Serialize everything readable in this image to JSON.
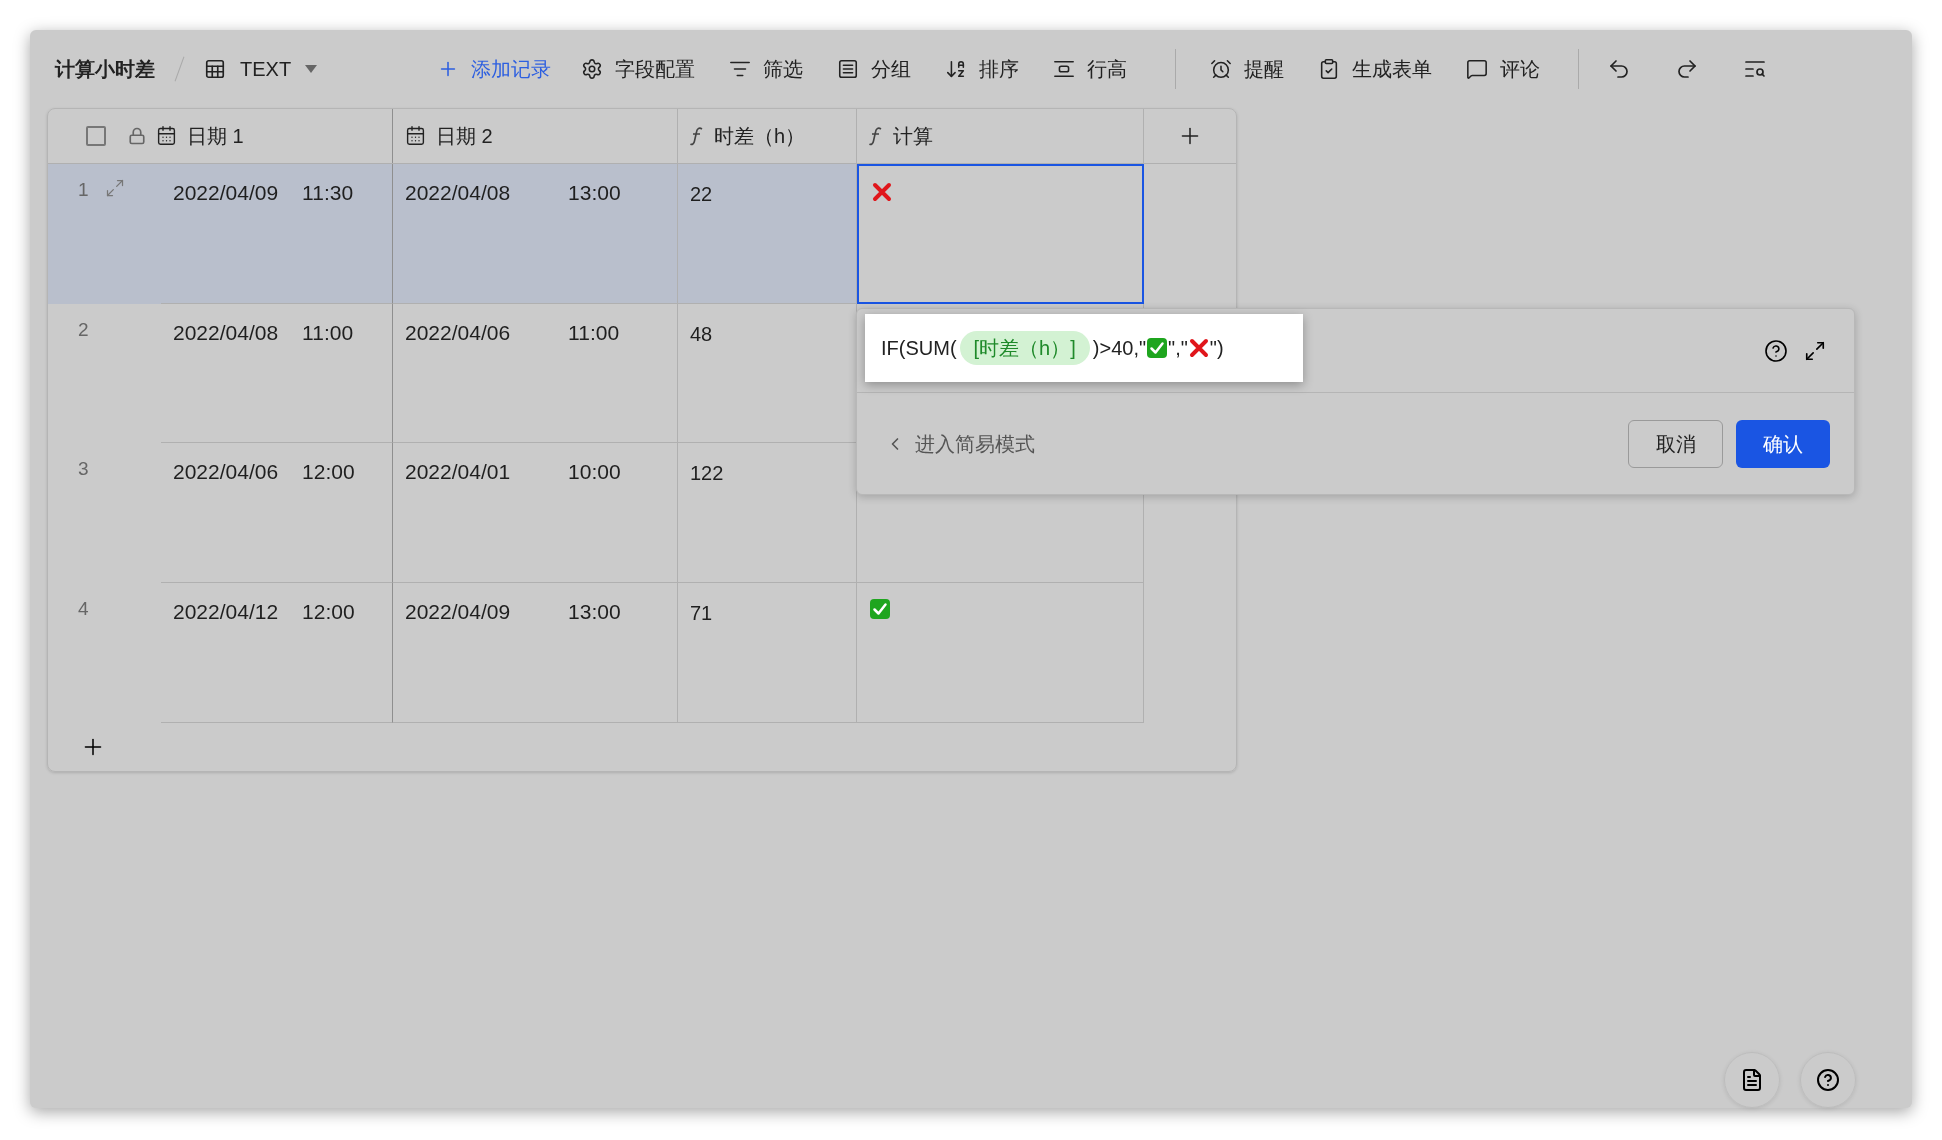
{
  "app": {
    "title": "计算小时差"
  },
  "view": {
    "name": "TEXT"
  },
  "toolbar_groups": [
    [
      {
        "kind": "add",
        "label": "添加记录"
      },
      {
        "kind": "fields",
        "label": "字段配置"
      },
      {
        "kind": "filter",
        "label": "筛选"
      },
      {
        "kind": "group",
        "label": "分组"
      },
      {
        "kind": "sort",
        "label": "排序"
      },
      {
        "kind": "row_height",
        "label": "行高"
      }
    ],
    [
      {
        "kind": "reminder",
        "label": "提醒"
      },
      {
        "kind": "form",
        "label": "生成表单"
      },
      {
        "kind": "comment",
        "label": "评论"
      }
    ]
  ],
  "table": {
    "select_all": {
      "checked": false
    },
    "columns": [
      {
        "kind": "date",
        "label": "日期 1",
        "locked": true
      },
      {
        "kind": "date",
        "label": "日期 2",
        "locked": false
      },
      {
        "kind": "formula",
        "label": "时差（h）",
        "locked": false
      },
      {
        "kind": "formula",
        "label": "计算",
        "locked": false
      }
    ],
    "rows": [
      {
        "number": "1",
        "selected": true,
        "date_1": {
          "date": "2022/04/09",
          "time": "11:30"
        },
        "date_2": {
          "date": "2022/04/08",
          "time": "13:00"
        },
        "diff": "22",
        "result": {
          "kind": "cross"
        },
        "active_cell": true
      },
      {
        "number": "2",
        "selected": false,
        "date_1": {
          "date": "2022/04/08",
          "time": "11:00"
        },
        "date_2": {
          "date": "2022/04/06",
          "time": "11:00"
        },
        "diff": "48",
        "active_cell": false
      },
      {
        "number": "3",
        "selected": false,
        "date_1": {
          "date": "2022/04/06",
          "time": "12:00"
        },
        "date_2": {
          "date": "2022/04/01",
          "time": "10:00"
        },
        "diff": "122",
        "active_cell": false
      },
      {
        "number": "4",
        "selected": false,
        "date_1": {
          "date": "2022/04/12",
          "time": "12:00"
        },
        "date_2": {
          "date": "2022/04/09",
          "time": "13:00"
        },
        "diff": "71",
        "result": {
          "kind": "check"
        },
        "active_cell": false
      }
    ]
  },
  "formula_popup": {
    "formula": [
      {
        "kind": "text",
        "text": "IF(SUM("
      },
      {
        "kind": "field",
        "text": "[时差（h）]"
      },
      {
        "kind": "text",
        "text": ")>40,\""
      },
      {
        "kind": "check"
      },
      {
        "kind": "text",
        "text": "\",\""
      },
      {
        "kind": "cross"
      },
      {
        "kind": "text",
        "text": "\")"
      }
    ],
    "simple_mode_link": "进入简易模式",
    "cancel": "取消",
    "confirm": "确认"
  }
}
